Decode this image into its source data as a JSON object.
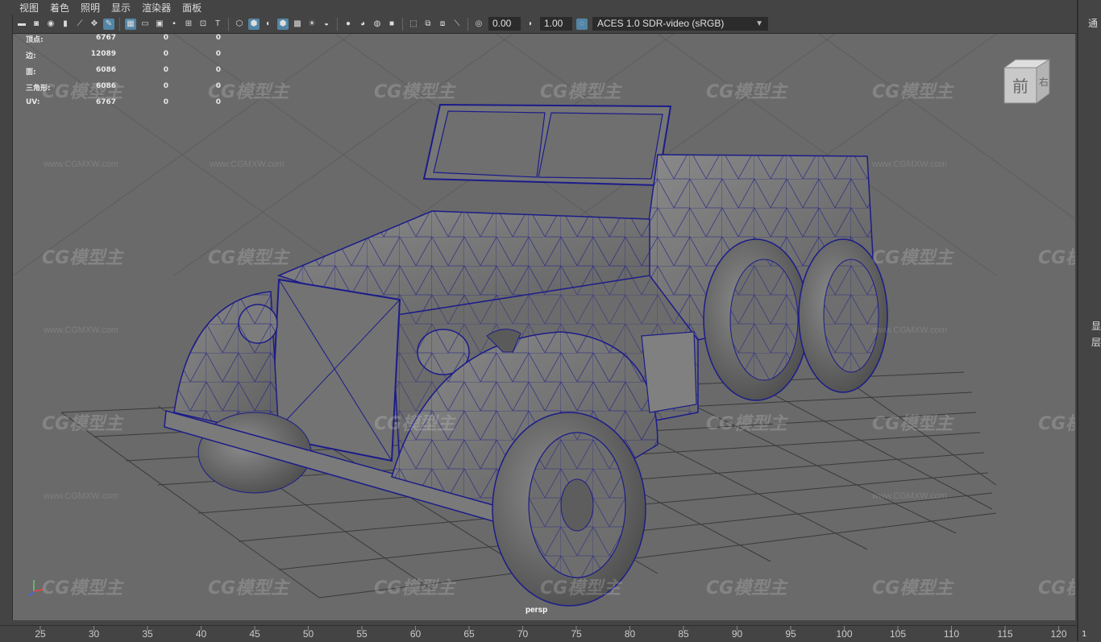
{
  "menubar": {
    "items": [
      "视图",
      "着色",
      "照明",
      "显示",
      "渲染器",
      "面板"
    ]
  },
  "toolbar": {
    "exposure_value": "0.00",
    "gamma_value": "1.00",
    "color_space": "ACES 1.0 SDR-video (sRGB)",
    "accent_color": "#5285a6"
  },
  "hud": {
    "rows": [
      {
        "label": "顶点:",
        "value": "6767",
        "a": "0",
        "b": "0"
      },
      {
        "label": "边:",
        "value": "12089",
        "a": "0",
        "b": "0"
      },
      {
        "label": "面:",
        "value": "6086",
        "a": "0",
        "b": "0"
      },
      {
        "label": "三角形:",
        "value": "6086",
        "a": "0",
        "b": "0"
      },
      {
        "label": "UV:",
        "value": "6767",
        "a": "0",
        "b": "0"
      }
    ]
  },
  "viewport": {
    "camera_label": "persp",
    "viewcube_front": "前",
    "viewcube_right": "右",
    "wire_color": "#1c1c8a"
  },
  "right_panel": {
    "top_label": "通",
    "mid_label_1": "显",
    "mid_label_2": "层",
    "bottom_label": "1"
  },
  "timeline": {
    "ticks": [
      "25",
      "30",
      "35",
      "40",
      "45",
      "50",
      "55",
      "60",
      "65",
      "70",
      "75",
      "80",
      "85",
      "90",
      "95",
      "100",
      "105",
      "110",
      "115",
      "120"
    ]
  },
  "watermark": {
    "logo": "CG模型主",
    "url": "www.CGMXW.com"
  }
}
